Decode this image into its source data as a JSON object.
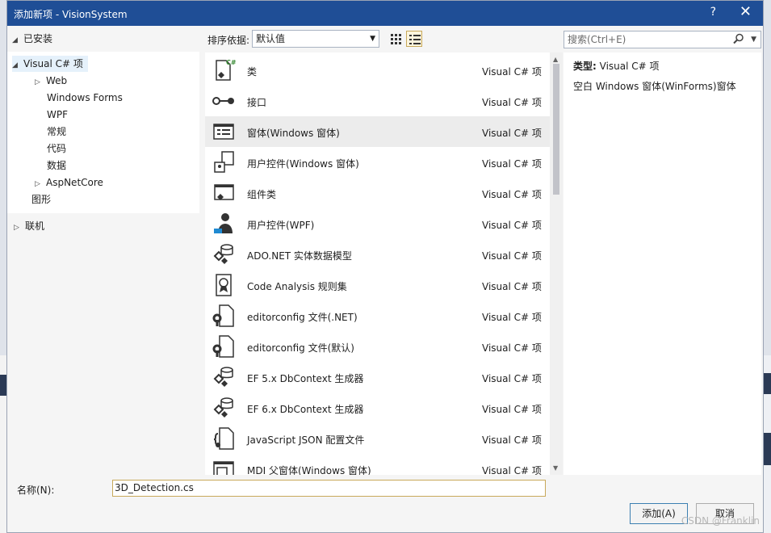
{
  "window": {
    "title": "添加新项 - VisionSystem",
    "help_label": "?",
    "close_label": "✕"
  },
  "tree": {
    "installed_label": "已安装",
    "items": [
      {
        "label": "Visual C# 项",
        "expanded": true,
        "selected": true
      },
      {
        "label": "Web",
        "expandable": true
      },
      {
        "label": "Windows Forms"
      },
      {
        "label": "WPF"
      },
      {
        "label": "常规"
      },
      {
        "label": "代码"
      },
      {
        "label": "数据"
      },
      {
        "label": "AspNetCore",
        "expandable": true
      },
      {
        "label": "图形"
      }
    ],
    "online_label": "联机"
  },
  "toolbar": {
    "sort_label": "排序依据:",
    "sort_value": "默认值",
    "search_placeholder": "搜索(Ctrl+E)"
  },
  "items": [
    {
      "name": "类",
      "type": "Visual C# 项",
      "icon": "class-icon"
    },
    {
      "name": "接口",
      "type": "Visual C# 项",
      "icon": "interface-icon"
    },
    {
      "name": "窗体(Windows 窗体)",
      "type": "Visual C# 项",
      "icon": "form-icon",
      "selected": true
    },
    {
      "name": "用户控件(Windows 窗体)",
      "type": "Visual C# 项",
      "icon": "user-control-icon"
    },
    {
      "name": "组件类",
      "type": "Visual C# 项",
      "icon": "component-icon"
    },
    {
      "name": "用户控件(WPF)",
      "type": "Visual C# 项",
      "icon": "wpf-user-control-icon"
    },
    {
      "name": "ADO.NET 实体数据模型",
      "type": "Visual C# 项",
      "icon": "data-model-icon"
    },
    {
      "name": "Code Analysis 规则集",
      "type": "Visual C# 项",
      "icon": "ruleset-icon"
    },
    {
      "name": "editorconfig 文件(.NET)",
      "type": "Visual C# 项",
      "icon": "config-file-icon"
    },
    {
      "name": "editorconfig 文件(默认)",
      "type": "Visual C# 项",
      "icon": "config-file-icon"
    },
    {
      "name": "EF 5.x DbContext 生成器",
      "type": "Visual C# 项",
      "icon": "generator-icon"
    },
    {
      "name": "EF 6.x DbContext 生成器",
      "type": "Visual C# 项",
      "icon": "generator-icon"
    },
    {
      "name": "JavaScript JSON 配置文件",
      "type": "Visual C# 项",
      "icon": "json-file-icon"
    },
    {
      "name": "MDI 父窗体(Windows 窗体)",
      "type": "Visual C# 项",
      "icon": "mdi-form-icon"
    }
  ],
  "details": {
    "type_label": "类型:",
    "type_value": "Visual C# 项",
    "description": "空白 Windows 窗体(WinForms)窗体"
  },
  "bottom": {
    "name_label": "名称(N):",
    "name_value": "3D_Detection.cs",
    "add_label": "添加(A)",
    "cancel_label": "取消"
  },
  "watermark": "CSDN @Franklin"
}
